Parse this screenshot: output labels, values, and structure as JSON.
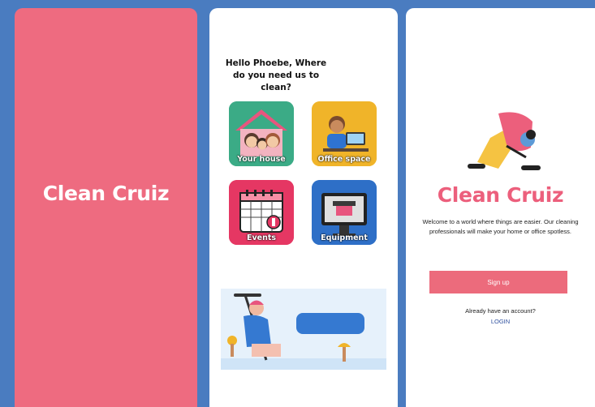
{
  "splash": {
    "title": "Clean Cruiz"
  },
  "home": {
    "greeting": "Hello Phoebe, Where do you need us to clean?",
    "tiles": [
      {
        "label": "Your house",
        "icon": "house-icon"
      },
      {
        "label": "Office space",
        "icon": "office-icon"
      },
      {
        "label": "Events",
        "icon": "calendar-icon"
      },
      {
        "label": "Equipment",
        "icon": "monitor-icon"
      }
    ],
    "banner_icon": "cleaner-illustration"
  },
  "welcome": {
    "brand": "Clean Cruiz",
    "description": "Welcome to a world where things are easier. Our cleaning professionals will make your home or office spotless.",
    "signup_label": "Sign up",
    "account_prompt": "Already have an account?",
    "login_label": "LOGIN"
  },
  "colors": {
    "accent_pink": "#ec6b7c",
    "background_blue": "#4a7cc0"
  }
}
